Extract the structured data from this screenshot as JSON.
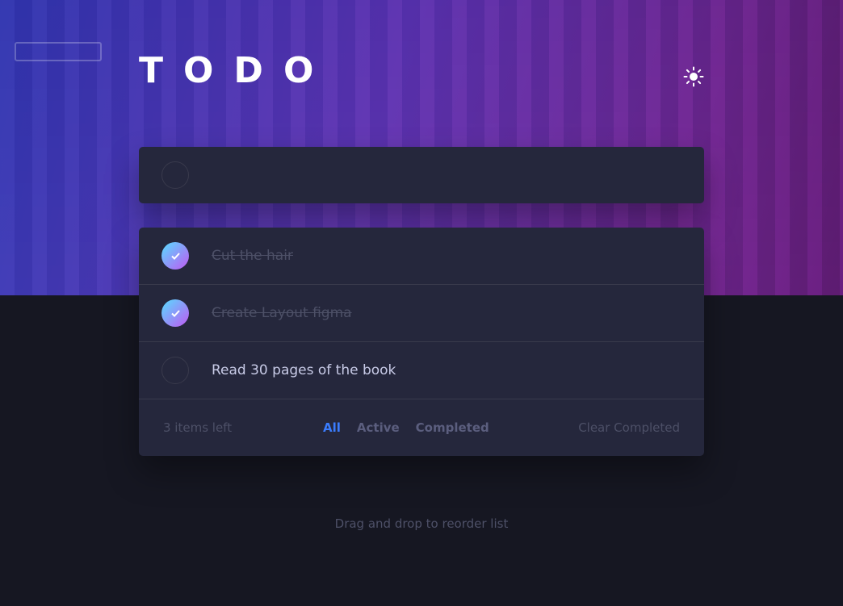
{
  "header": {
    "title": "TODO",
    "theme_icon": "sun-icon"
  },
  "new_todo": {
    "value": "",
    "placeholder": ""
  },
  "todos": [
    {
      "text": "Cut the hair",
      "completed": true
    },
    {
      "text": "Create Layout figma",
      "completed": true
    },
    {
      "text": "Read 30 pages of the book",
      "completed": false
    }
  ],
  "footer": {
    "items_left": "3 items left",
    "filters": [
      "All",
      "Active",
      "Completed"
    ],
    "active_filter": "All",
    "clear_label": "Clear Completed"
  },
  "hint": "Drag and drop to reorder list",
  "colors": {
    "background": "#161722",
    "card": "#25273c",
    "accent": "#3a7cfd",
    "check_gradient_start": "#57ddff",
    "check_gradient_end": "#c058f3"
  }
}
